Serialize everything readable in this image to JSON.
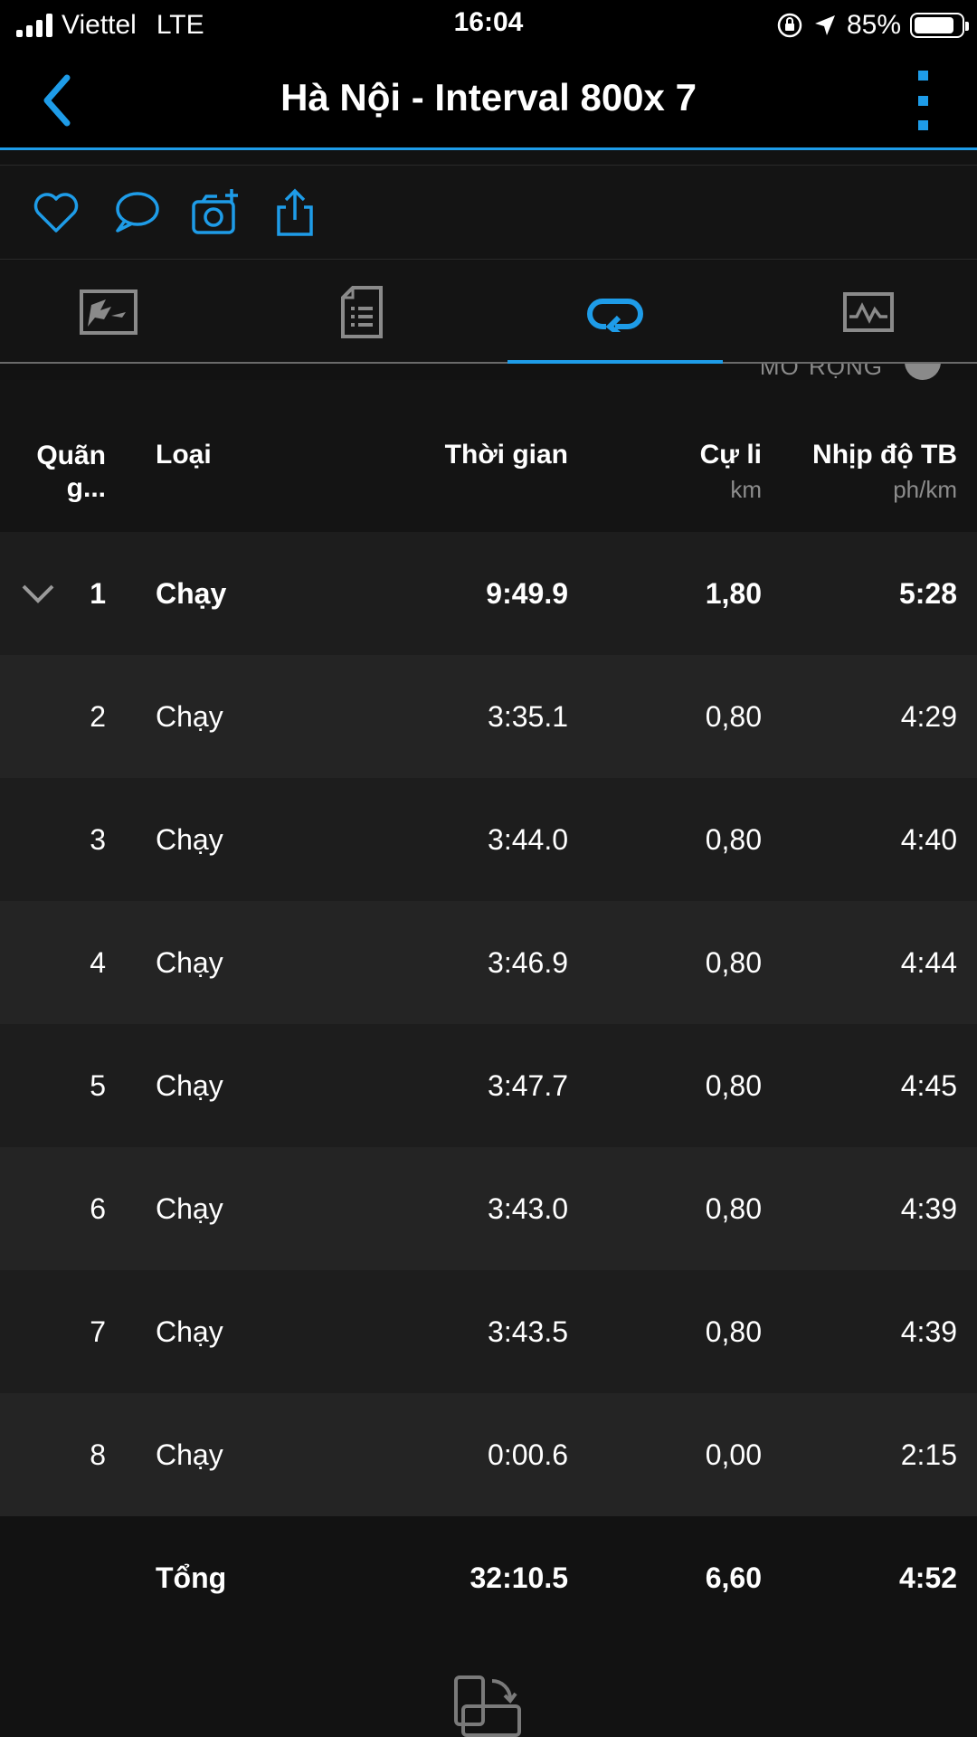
{
  "status_bar": {
    "carrier": "Viettel",
    "network": "LTE",
    "time": "16:04",
    "battery": "85%",
    "battery_level": 0.85
  },
  "header": {
    "title": "Hà Nội - Interval 800x 7",
    "back_icon": "chevron-left-icon",
    "menu_icon": "more-vertical-icon",
    "accent_color": "#1e9ce8"
  },
  "actions": [
    {
      "icon": "heart-icon"
    },
    {
      "icon": "comment-icon"
    },
    {
      "icon": "add-photo-icon"
    },
    {
      "icon": "share-icon"
    }
  ],
  "tabs": [
    {
      "icon": "map-icon",
      "active": false
    },
    {
      "icon": "details-icon",
      "active": false
    },
    {
      "icon": "laps-icon",
      "active": true
    },
    {
      "icon": "charts-icon",
      "active": false
    }
  ],
  "expand": {
    "label": "MỞ RỘNG"
  },
  "table": {
    "columns": {
      "lap": "Quãn\ng...",
      "type": "Loại",
      "time": "Thời gian",
      "distance": "Cự li",
      "distance_unit": "km",
      "pace": "Nhịp độ TB",
      "pace_unit": "ph/km"
    },
    "rows": [
      {
        "lap": "1",
        "type": "Chạy",
        "time": "9:49.9",
        "distance": "1,80",
        "pace": "5:28"
      },
      {
        "lap": "2",
        "type": "Chạy",
        "time": "3:35.1",
        "distance": "0,80",
        "pace": "4:29"
      },
      {
        "lap": "3",
        "type": "Chạy",
        "time": "3:44.0",
        "distance": "0,80",
        "pace": "4:40"
      },
      {
        "lap": "4",
        "type": "Chạy",
        "time": "3:46.9",
        "distance": "0,80",
        "pace": "4:44"
      },
      {
        "lap": "5",
        "type": "Chạy",
        "time": "3:47.7",
        "distance": "0,80",
        "pace": "4:45"
      },
      {
        "lap": "6",
        "type": "Chạy",
        "time": "3:43.0",
        "distance": "0,80",
        "pace": "4:39"
      },
      {
        "lap": "7",
        "type": "Chạy",
        "time": "3:43.5",
        "distance": "0,80",
        "pace": "4:39"
      },
      {
        "lap": "8",
        "type": "Chạy",
        "time": "0:00.6",
        "distance": "0,00",
        "pace": "2:15"
      }
    ],
    "total": {
      "label": "Tổng",
      "time": "32:10.5",
      "distance": "6,60",
      "pace": "4:52"
    }
  },
  "footer": {
    "icon": "rotate-device-icon"
  }
}
